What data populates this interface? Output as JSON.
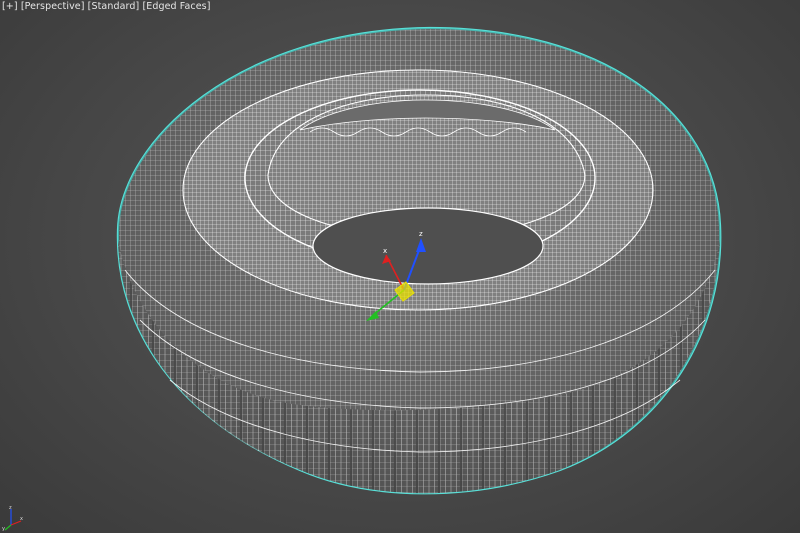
{
  "viewport": {
    "menus": [
      {
        "label": "[+]",
        "name": "viewport-menu-general"
      },
      {
        "label": "[Perspective]",
        "name": "viewport-menu-pov"
      },
      {
        "label": "[Standard]",
        "name": "viewport-menu-shading-standard"
      },
      {
        "label": "[Edged Faces]",
        "name": "viewport-menu-display-mode"
      }
    ],
    "background_color": "#4a4a4a",
    "selection_color": "#58e0d8",
    "wire_color": "#ffffff"
  },
  "object": {
    "type": "tire",
    "display": "wireframe-edged-faces",
    "selected": true
  },
  "gizmo": {
    "x_axis_label": "x",
    "y_axis_label": "y",
    "z_axis_label": "z",
    "x_color": "#e02020",
    "y_color": "#22c022",
    "z_color": "#2050ff",
    "plane_color": "#e8e000"
  },
  "world_axis": {
    "x_label": "x",
    "y_label": "y",
    "z_label": "z"
  }
}
